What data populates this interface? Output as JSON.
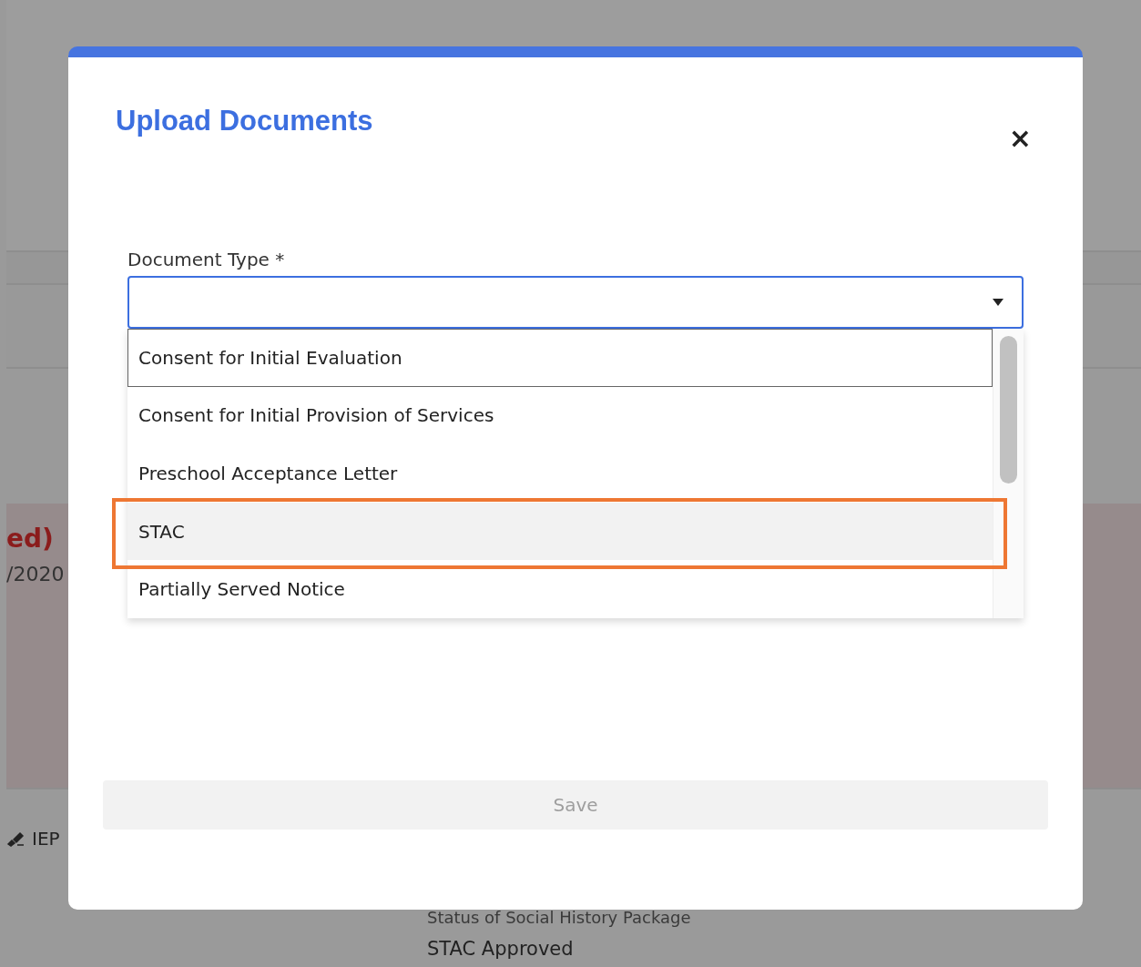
{
  "background": {
    "alert_title": "ed)",
    "alert_date": "/2020",
    "nav_label": "IEP",
    "status_label": "Status of Social History Package",
    "status_value": "STAC Approved"
  },
  "modal": {
    "title": "Upload Documents",
    "close": "×",
    "field": {
      "label": "Document Type *",
      "expanded": true
    },
    "options": [
      {
        "label": "Consent for Initial Evaluation",
        "focused": true,
        "hovered": false,
        "highlighted": false
      },
      {
        "label": "Consent for Initial Provision of Services",
        "focused": false,
        "hovered": false,
        "highlighted": false
      },
      {
        "label": "Preschool Acceptance Letter",
        "focused": false,
        "hovered": false,
        "highlighted": false
      },
      {
        "label": "STAC",
        "focused": false,
        "hovered": true,
        "highlighted": true
      },
      {
        "label": "Partially Served Notice",
        "focused": false,
        "hovered": false,
        "highlighted": false
      }
    ],
    "save": {
      "label": "Save",
      "disabled": true
    }
  }
}
